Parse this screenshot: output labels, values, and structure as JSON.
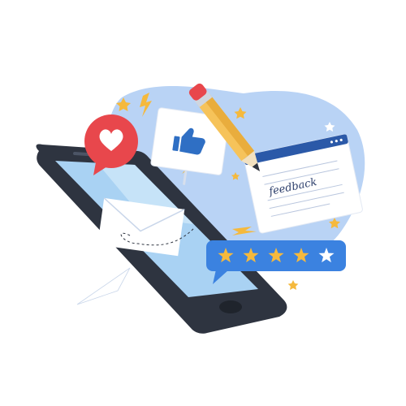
{
  "illustration": {
    "form_heading": "feedback",
    "rating": {
      "filled_stars": 4,
      "total_stars": 5
    },
    "icons": [
      "heart-icon",
      "thumbs-up-icon",
      "envelope-icon",
      "pencil-icon",
      "star-icon",
      "lightning-icon",
      "smartphone-icon"
    ]
  },
  "colors": {
    "blob": "#b9d3f5",
    "phone_body": "#2e3440",
    "screen": "#a9d2f3",
    "heart_badge": "#e8474c",
    "rating_bar": "#3b82e0",
    "star_filled": "#f5b93d",
    "star_empty": "#ffffff",
    "pencil": "#f6c35a",
    "form_header": "#2b59a8",
    "thumb": "#2f6fc4",
    "spark": "#f5b93d"
  }
}
